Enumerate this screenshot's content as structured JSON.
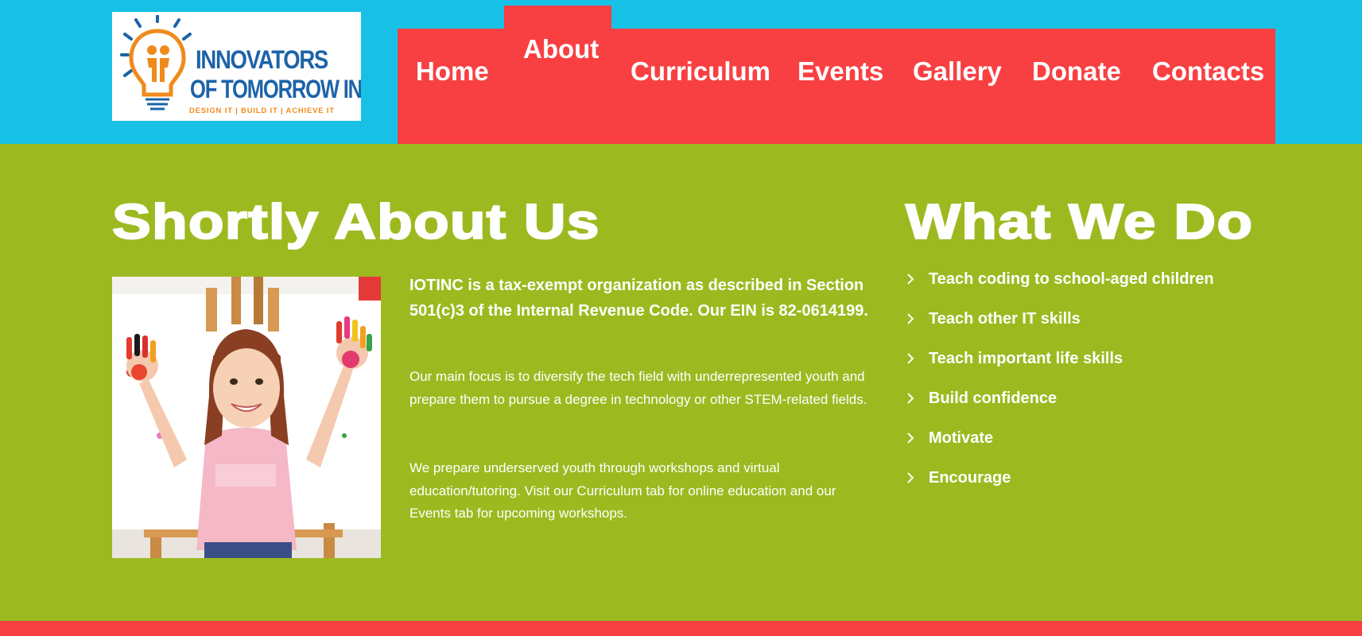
{
  "colors": {
    "header_bg": "#17c1e6",
    "nav_bg": "#f84043",
    "main_bg": "#9cba20",
    "text": "#ffffff",
    "logo_blue": "#1d63a8",
    "logo_orange": "#f08a1c"
  },
  "logo": {
    "line1": "INNOVATORS",
    "line2": "OF TOMORROW INC.",
    "tagline": "DESIGN IT | BUILD IT | ACHIEVE IT",
    "icon": "lightbulb-icon"
  },
  "nav": {
    "items": [
      {
        "label": "Home",
        "active": false
      },
      {
        "label": "About",
        "active": true
      },
      {
        "label": "Curriculum",
        "active": false
      },
      {
        "label": "Events",
        "active": false
      },
      {
        "label": "Gallery",
        "active": false
      },
      {
        "label": "Donate",
        "active": false
      },
      {
        "label": "Contacts",
        "active": false
      }
    ]
  },
  "about": {
    "heading": "Shortly About Us",
    "lead": "IOTINC is a tax-exempt organization as described in Section 501(c)3 of the Internal Revenue Code. Our EIN is 82-0614199.",
    "paragraphs": [
      "Our main focus is to diversify the tech field with underrepresented youth and prepare them to pursue a degree in technology or other STEM-related fields.",
      "We prepare underserved youth through workshops and virtual education/tutoring. Visit our Curriculum tab for online education and our Events tab for upcoming workshops."
    ]
  },
  "what_we_do": {
    "heading": "What We Do",
    "icon": "chevron-right-icon",
    "items": [
      "Teach coding to school-aged children",
      "Teach other IT skills",
      "Teach important life skills",
      "Build confidence",
      "Motivate",
      "Encourage"
    ]
  }
}
